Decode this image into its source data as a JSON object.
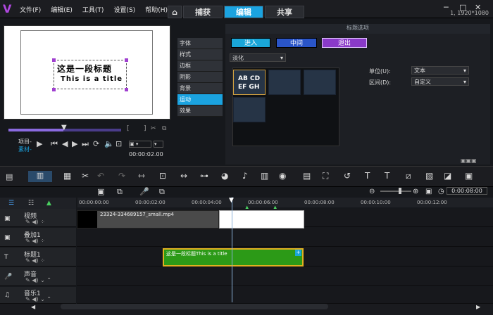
{
  "menu": {
    "file": "文件(F)",
    "edit": "编辑(E)",
    "tools": "工具(T)",
    "settings": "设置(S)",
    "help": "帮助(H)"
  },
  "tabs": {
    "capture": "捕获",
    "edit": "编辑",
    "share": "共享"
  },
  "resolution": "1, 1920*1080",
  "preview": {
    "title_cn": "这是一段标题",
    "title_en": "This is a title"
  },
  "controls": {
    "project_label": "项目-",
    "clip_label": "素材-",
    "timecode": "00:00:02.00"
  },
  "side_menu": [
    "字体",
    "样式",
    "边框",
    "阴影",
    "背景",
    "运动",
    "效果"
  ],
  "options": {
    "header": "标题选项",
    "enter": "进入",
    "middle": "中间",
    "exit": "退出",
    "effect": "淡化",
    "sample_text_1": "AB CD",
    "sample_text_2": "EF GH",
    "unit_label": "单位(U):",
    "unit_value": "文本",
    "interval_label": "区间(D):",
    "interval_value": "自定义"
  },
  "timeline": {
    "timecode": "0:00:08:00",
    "ruler": [
      "00:00:00:00",
      "00:00:02:00",
      "00:00:04:00",
      "00:00:06:00",
      "00:00:08:00",
      "00:00:10:00",
      "00:00:12:00"
    ],
    "tracks": [
      {
        "name": "视频",
        "icon": "video-track-icon"
      },
      {
        "name": "叠加1",
        "icon": "overlay-track-icon"
      },
      {
        "name": "标题1",
        "icon": "title-track-icon"
      },
      {
        "name": "声音",
        "icon": "voice-track-icon"
      },
      {
        "name": "音乐1",
        "icon": "music-track-icon"
      }
    ],
    "video_clip": "23324-334689157_small.mp4",
    "title_clip": "这是一段标题This is a title"
  },
  "colors": {
    "accent": "#1ba3e0",
    "enter": "#1aa6d8",
    "middle": "#2a55c8",
    "exit": "#8a3ac8",
    "title_clip": "#2c9a17"
  }
}
